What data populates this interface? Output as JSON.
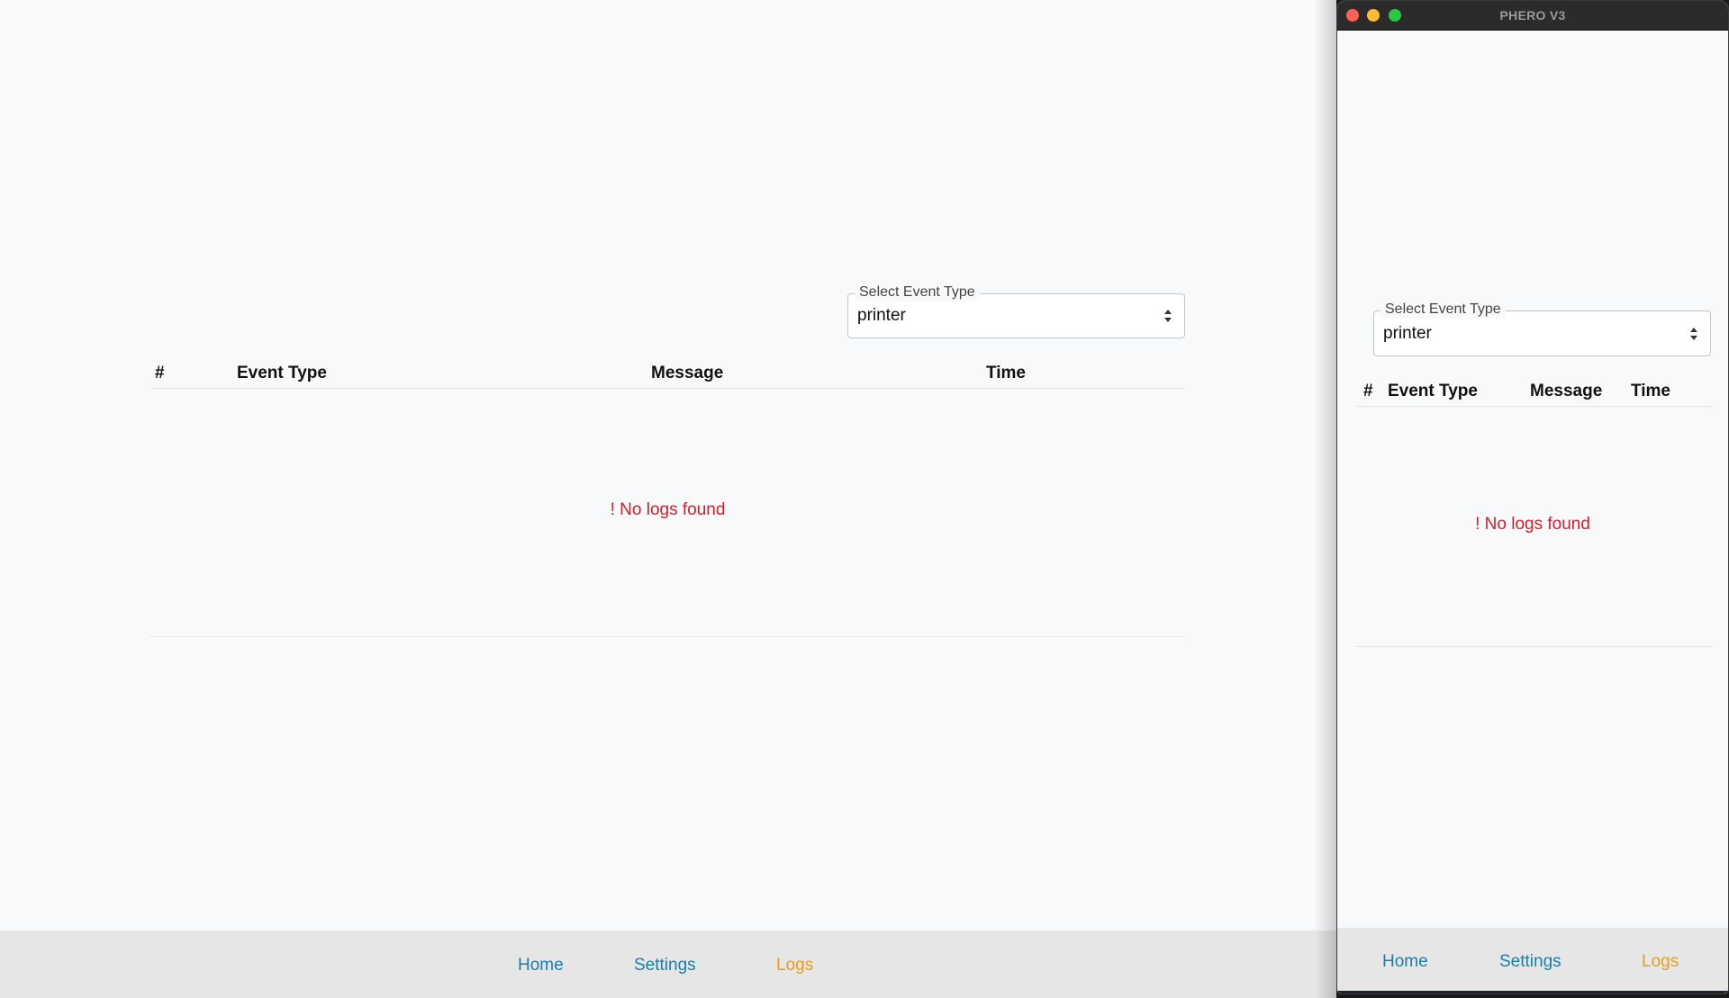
{
  "main_window": {
    "event_select": {
      "label": "Select Event Type",
      "value": "printer"
    },
    "table": {
      "headers": [
        "#",
        "Event Type",
        "Message",
        "Time"
      ],
      "rows": [],
      "empty_message": "! No logs found"
    },
    "nav": {
      "home": "Home",
      "settings": "Settings",
      "logs": "Logs",
      "active": "Logs"
    }
  },
  "small_window": {
    "title": "PHERO V3",
    "event_select": {
      "label": "Select Event Type",
      "value": "printer"
    },
    "table": {
      "headers": [
        "#",
        "Event Type",
        "Message",
        "Time"
      ],
      "rows": [],
      "empty_message": "! No logs found"
    },
    "nav": {
      "home": "Home",
      "settings": "Settings",
      "logs": "Logs",
      "active": "Logs"
    }
  },
  "colors": {
    "nav_link": "#1a7ea6",
    "nav_active": "#e0a020",
    "error_text": "#d0202a",
    "background": "#f8f9fb",
    "footer": "#e6e6e6"
  }
}
